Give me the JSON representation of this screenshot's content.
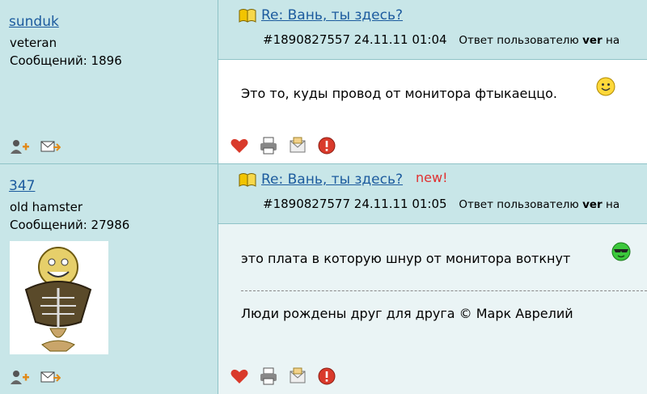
{
  "posts": [
    {
      "author": {
        "name": "sunduk",
        "rank": "veteran",
        "messages_label": "Сообщений: 1896"
      },
      "title": "Re: Вань, ты здесь?",
      "meta": {
        "id_date": "#1890827557 24.11.11 01:04",
        "reply_prefix": "Ответ пользователю",
        "reply_user": "ver",
        "reply_suffix": "на"
      },
      "message": "Это то, куды провод от монитора фтыкаеццо.",
      "new_label": ""
    },
    {
      "author": {
        "name": "347",
        "rank": "old hamster",
        "messages_label": "Сообщений: 27986"
      },
      "title": "Re: Вань, ты здесь?",
      "meta": {
        "id_date": "#1890827577 24.11.11 01:05",
        "reply_prefix": "Ответ пользователю",
        "reply_user": "ver",
        "reply_suffix": "на"
      },
      "message": "это плата в которую шнур от монитора воткнут",
      "signature": "Люди рождены друг для друга © Марк Аврелий",
      "new_label": "new!"
    }
  ],
  "icons": {
    "author_actions": [
      "add-friend-icon",
      "send-message-icon"
    ],
    "post_actions": [
      "heart-icon",
      "print-icon",
      "email-icon",
      "report-icon"
    ]
  }
}
